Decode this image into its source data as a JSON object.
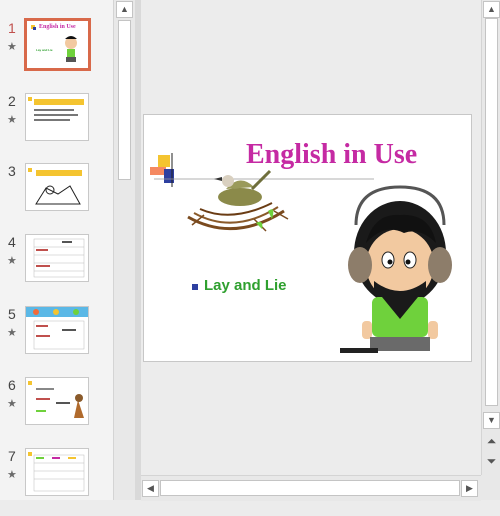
{
  "thumbnails": [
    {
      "number": "1",
      "star": "★",
      "active": true,
      "title": "English in Use",
      "subtitle": "Lay and Lie"
    },
    {
      "number": "2",
      "star": "★",
      "active": false
    },
    {
      "number": "3",
      "star": "",
      "active": false
    },
    {
      "number": "4",
      "star": "★",
      "active": false
    },
    {
      "number": "5",
      "star": "★",
      "active": false
    },
    {
      "number": "6",
      "star": "★",
      "active": false
    },
    {
      "number": "7",
      "star": "★",
      "active": false
    }
  ],
  "slide": {
    "title": "English in Use",
    "bullet": "Lay and Lie"
  },
  "scroll_arrows": {
    "up": "▲",
    "down": "▼",
    "left": "◀",
    "right": "▶",
    "prev_slide": "⏶",
    "next_slide": "⏷"
  },
  "colors": {
    "title": "#c52aa3",
    "bullet_text": "#2fa02f",
    "bullet_marker": "#2e3fa0",
    "active_thumbnail_border": "#d8694a",
    "active_thumbnail_number": "#c0504d"
  }
}
